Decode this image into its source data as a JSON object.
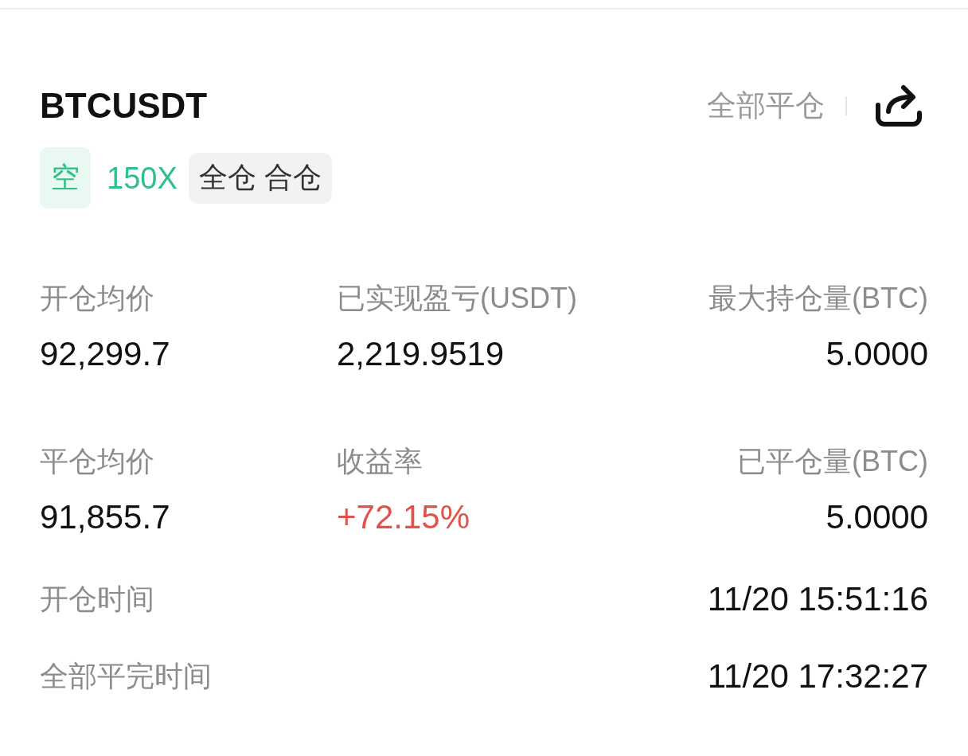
{
  "header": {
    "symbol": "BTCUSDT",
    "close_all": "全部平仓"
  },
  "tags": [
    {
      "kind": "side",
      "text": "空"
    },
    {
      "kind": "leverage",
      "text": "150X"
    },
    {
      "kind": "mode",
      "text": "全仓 合仓"
    }
  ],
  "stats": [
    {
      "label": "开仓均价",
      "value": "92,299.7",
      "color": "#111111"
    },
    {
      "label": "已实现盈亏(USDT)",
      "value": "2,219.9519",
      "color": "#111111"
    },
    {
      "label": "最大持仓量(BTC)",
      "value": "5.0000",
      "color": "#111111"
    },
    {
      "label": "平仓均价",
      "value": "91,855.7",
      "color": "#111111"
    },
    {
      "label": "收益率",
      "value": "+72.15%",
      "color": "#e0524a"
    },
    {
      "label": "已平仓量(BTC)",
      "value": "5.0000",
      "color": "#111111"
    }
  ],
  "times": [
    {
      "label": "开仓时间",
      "value": "11/20 15:51:16"
    },
    {
      "label": "全部平完时间",
      "value": "11/20 17:32:27"
    }
  ]
}
